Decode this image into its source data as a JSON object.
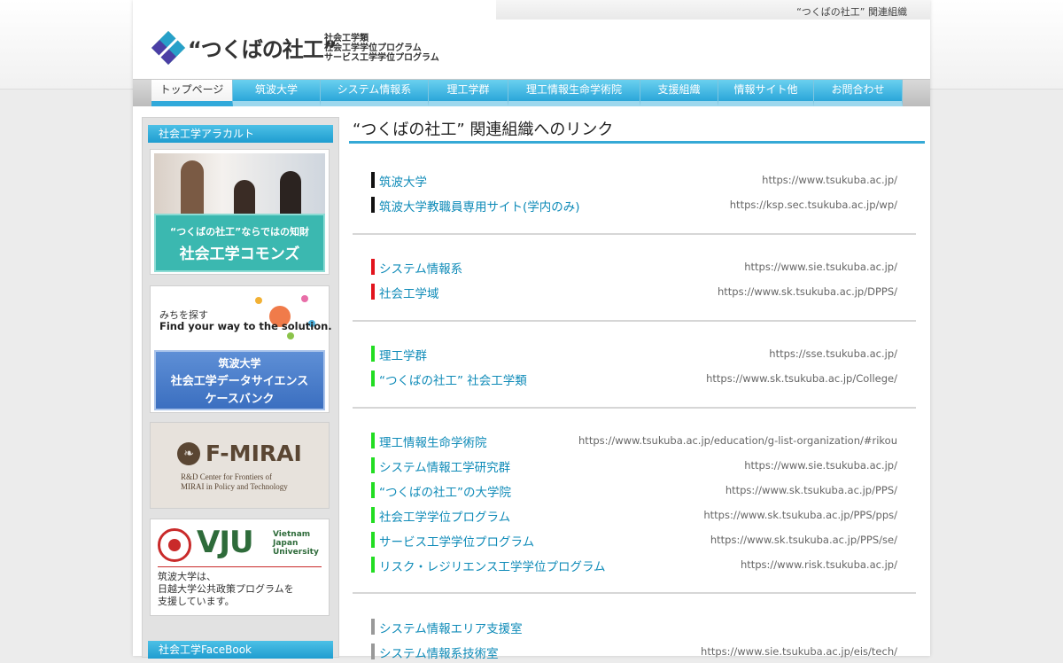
{
  "header": {
    "top_link": "“つくばの社工” 関連組織",
    "logo_text": "“つくばの社工”",
    "logo_sub": [
      "社会工学類",
      "社会工学学位プログラム",
      "サービス工学学位プログラム"
    ]
  },
  "nav": [
    {
      "label": "トップページ",
      "active": true
    },
    {
      "label": "筑波大学"
    },
    {
      "label": "システム情報系"
    },
    {
      "label": "理工学群"
    },
    {
      "label": "理工情報生命学術院"
    },
    {
      "label": "支援組織"
    },
    {
      "label": "情報サイト他"
    },
    {
      "label": "お問合わせ"
    }
  ],
  "sidebar": {
    "heading": "社会工学アラカルト",
    "banner1": {
      "line1": "“つくばの社工”ならではの知財",
      "line2": "社会工学コモンズ"
    },
    "banner2": {
      "line1": "みちを探す",
      "line2": "Find your way to the solution.",
      "line3": "筑波大学",
      "line4": "社会工学データサイエンス",
      "line5": "ケースバンク"
    },
    "banner3": {
      "title": "F-MIRAI",
      "line1": "R&D Center for Frontiers of",
      "line2": "MIRAI in Policy and Technology"
    },
    "banner4": {
      "title": "VJU",
      "sub1": "Vietnam",
      "sub2": "Japan",
      "sub3": "University",
      "line1": "筑波大学は、",
      "line2": "日越大学公共政策プログラムを",
      "line3": "支援しています。"
    },
    "heading2": "社会工学FaceBook"
  },
  "main": {
    "title": "“つくばの社工” 関連組織へのリンク",
    "groups": [
      {
        "color": "#111111",
        "links": [
          {
            "name": "筑波大学",
            "url": "https://www.tsukuba.ac.jp/"
          },
          {
            "name": "筑波大学教職員専用サイト(学内のみ)",
            "url": "https://ksp.sec.tsukuba.ac.jp/wp/"
          }
        ]
      },
      {
        "color": "#e2141d",
        "links": [
          {
            "name": "システム情報系",
            "url": "https://www.sie.tsukuba.ac.jp/"
          },
          {
            "name": "社会工学域",
            "url": "https://www.sk.tsukuba.ac.jp/DPPS/"
          }
        ]
      },
      {
        "color": "#22dd22",
        "links": [
          {
            "name": "理工学群",
            "url": "https://sse.tsukuba.ac.jp/"
          },
          {
            "name": "“つくばの社工” 社会工学類",
            "url": "https://www.sk.tsukuba.ac.jp/College/"
          }
        ]
      },
      {
        "color": "#22dd22",
        "links": [
          {
            "name": "理工情報生命学術院",
            "url": "https://www.tsukuba.ac.jp/education/g-list-organization/#rikou"
          },
          {
            "name": "システム情報工学研究群",
            "url": "https://www.sie.tsukuba.ac.jp/"
          },
          {
            "name": "“つくばの社工”の大学院",
            "url": "https://www.sk.tsukuba.ac.jp/PPS/"
          },
          {
            "name": "社会工学学位プログラム",
            "url": "https://www.sk.tsukuba.ac.jp/PPS/pps/"
          },
          {
            "name": "サービス工学学位プログラム",
            "url": "https://www.sk.tsukuba.ac.jp/PPS/se/"
          },
          {
            "name": "リスク・レジリエンス工学学位プログラム",
            "url": "https://www.risk.tsukuba.ac.jp/"
          }
        ]
      },
      {
        "color": "#999999",
        "links": [
          {
            "name": "システム情報エリア支援室",
            "url": ""
          },
          {
            "name": "システム情報系技術室",
            "url": "https://www.sie.tsukuba.ac.jp/eis/tech/"
          }
        ]
      }
    ]
  }
}
